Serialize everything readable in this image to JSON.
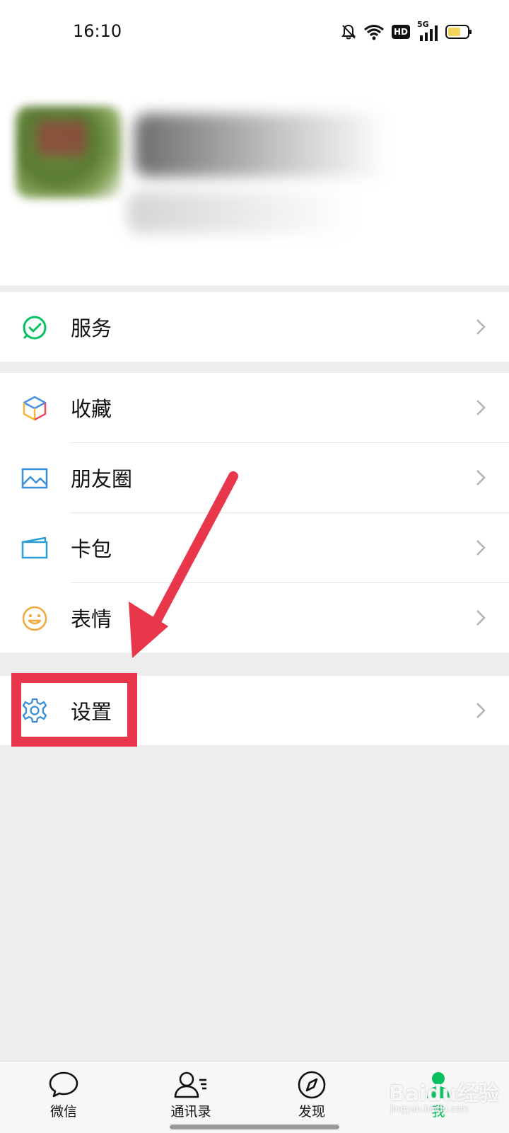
{
  "status_bar": {
    "time": "16:10",
    "network": "5G",
    "hd_badge": "HD"
  },
  "profile": {},
  "menu": {
    "services": {
      "label": "服务",
      "icon": "services-icon"
    },
    "favorites": {
      "label": "收藏",
      "icon": "favorites-cube-icon"
    },
    "moments": {
      "label": "朋友圈",
      "icon": "moments-image-icon"
    },
    "cards": {
      "label": "卡包",
      "icon": "card-wallet-icon"
    },
    "stickers": {
      "label": "表情",
      "icon": "smiley-icon"
    },
    "settings": {
      "label": "设置",
      "icon": "gear-icon"
    }
  },
  "tabbar": {
    "items": [
      {
        "label": "微信",
        "icon": "chat-bubble-icon",
        "active": false
      },
      {
        "label": "通讯录",
        "icon": "contacts-icon",
        "active": false
      },
      {
        "label": "发现",
        "icon": "compass-icon",
        "active": false
      },
      {
        "label": "我",
        "icon": "person-icon",
        "active": true
      }
    ]
  },
  "watermark": {
    "text": "Baidu经验",
    "sub": "jingyan.baidu.com"
  },
  "colors": {
    "accent": "#07c160",
    "annotation": "#e8364a",
    "background": "#ededed"
  }
}
